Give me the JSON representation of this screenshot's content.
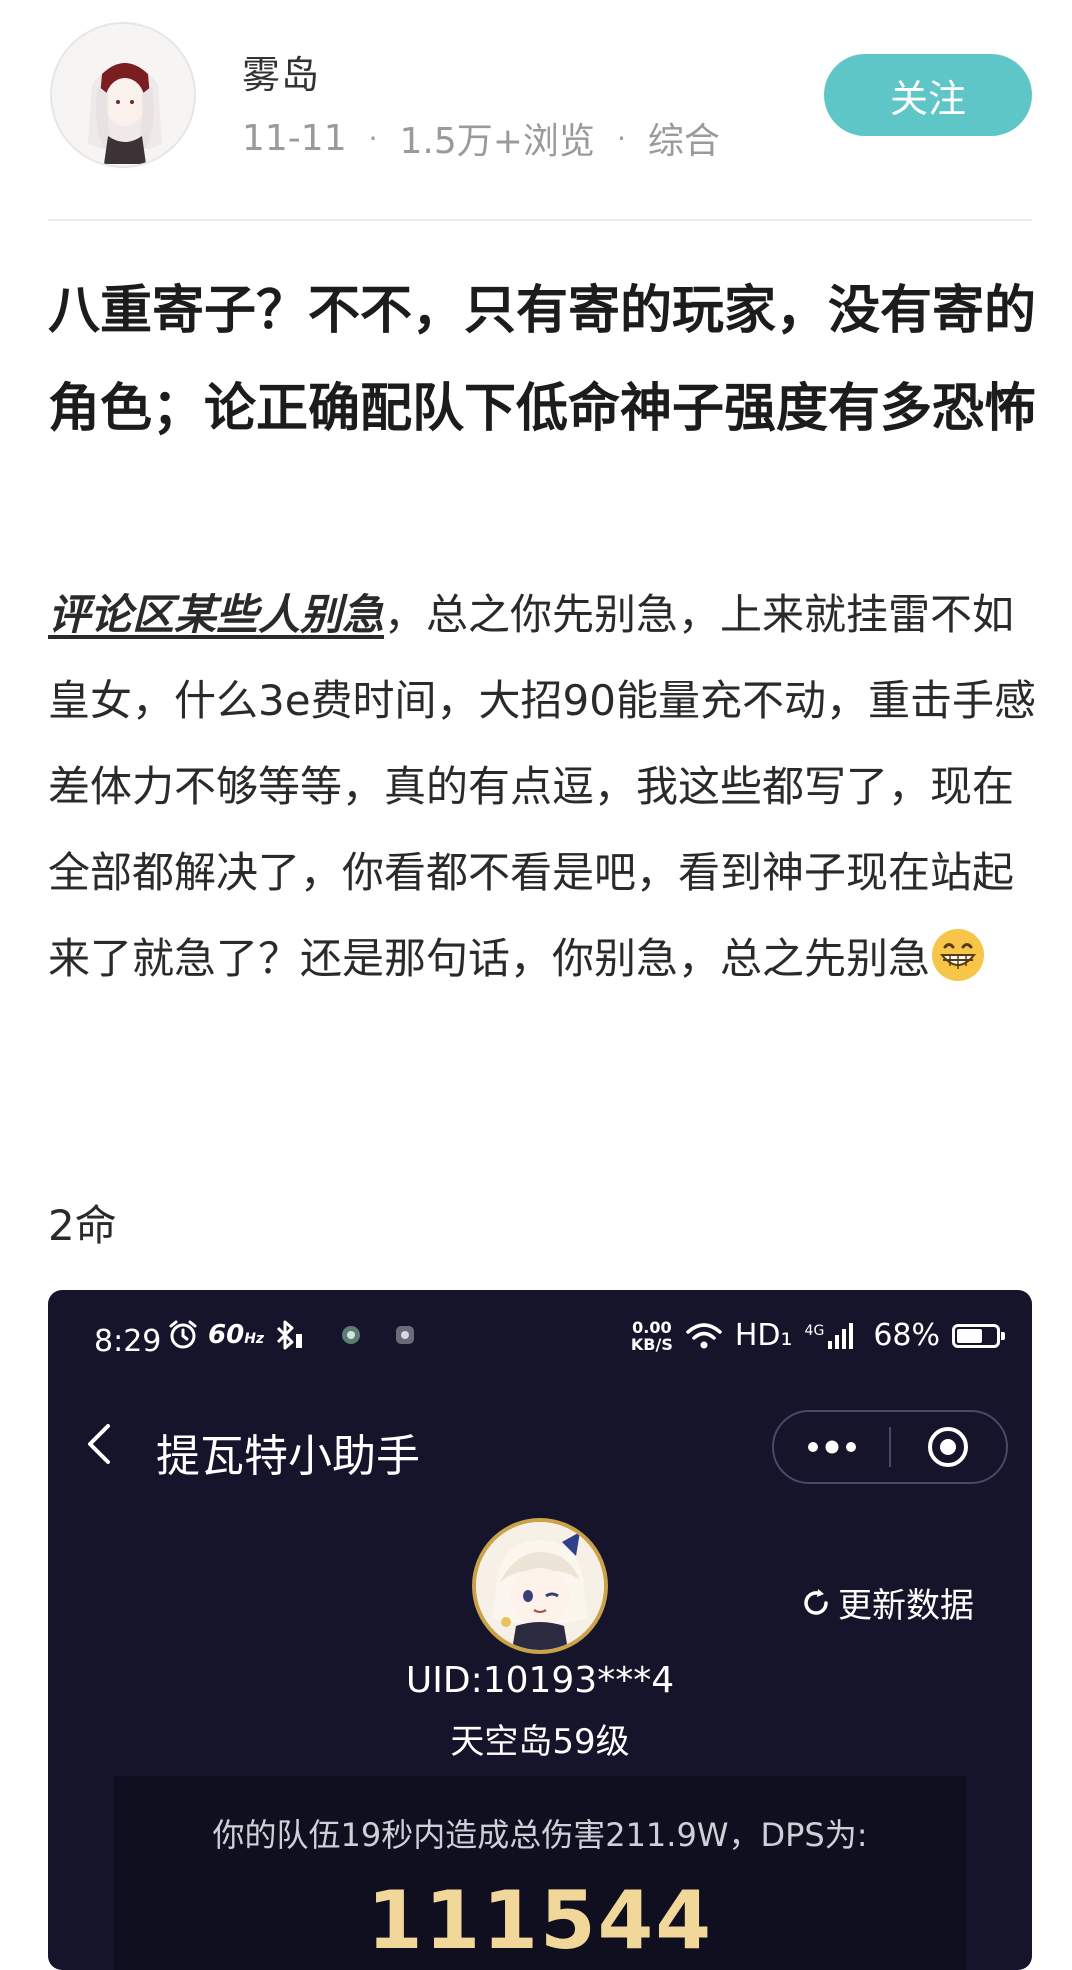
{
  "author": {
    "name": "雾岛",
    "date": "11-11",
    "views": "1.5万+浏览",
    "category": "综合",
    "follow_label": "关注"
  },
  "post": {
    "title": "八重寄子？不不，只有寄的玩家，没有寄的角色；论正确配队下低命神子强度有多恐怖",
    "body_lead": "评论区某些人别急",
    "body_rest": "，总之你先别急，上来就挂雷不如皇女，什么3e费时间，大招90能量充不动，重击手感差体力不够等等，真的有点逗，我这些都写了，现在全部都解决了，你看都不看是吧，看到神子现在站起来了就急了？还是那句话，你别急，总之先别急",
    "body_emoji": "grinning-face-icon",
    "section_label": "2命"
  },
  "embedded_screenshot": {
    "status_bar": {
      "time": "8:29",
      "refresh_rate": "60",
      "refresh_unit": "Hz",
      "net_speed_value": "0.00",
      "net_speed_unit": "KB/S",
      "hd": "HD₁",
      "network": "4G",
      "battery": "68%",
      "battery_level": 0.68
    },
    "nav": {
      "back_icon": "chevron-left-icon",
      "title": "提瓦特小助手",
      "more_icon": "more-dots-icon",
      "close_icon": "target-circle-icon"
    },
    "refresh_label": "更新数据",
    "uid": "UID:10193***4",
    "level": "天空岛59级",
    "dps_text": "你的队伍19秒内造成总伤害211.9W，DPS为:",
    "dps_value": "111544"
  },
  "colors": {
    "follow_button": "#5fc6c8",
    "embed_bg": "#16142a",
    "dps_value": "#f2d79a"
  }
}
